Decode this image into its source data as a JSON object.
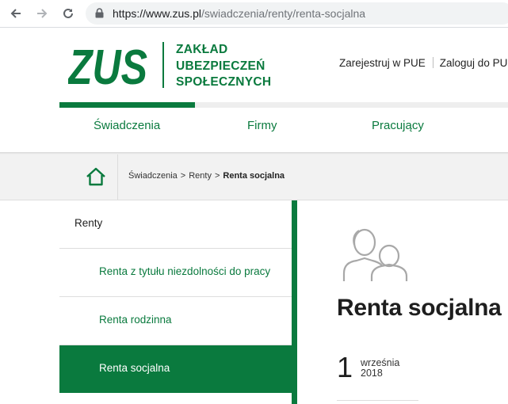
{
  "browser": {
    "url_host": "https://www.zus.pl",
    "url_path": "/swiadczenia/renty/renta-socjalna"
  },
  "header": {
    "logo_text": "ZUS",
    "name_line1": "ZAKŁAD",
    "name_line2": "UBEZPIECZEŃ",
    "name_line3": "SPOŁECZNYCH",
    "register_link": "Zarejestruj w PUE",
    "login_link": "Zaloguj do PU"
  },
  "colors": {
    "brand_green": "#0a7a3e",
    "breadcrumb_bg": "#f2f2f2"
  },
  "main_nav": {
    "items": [
      {
        "label": "Świadczenia",
        "active": true
      },
      {
        "label": "Firmy"
      },
      {
        "label": "Pracujący"
      }
    ]
  },
  "breadcrumb": {
    "home_icon": "home-icon",
    "items": [
      "Świadczenia",
      "Renty",
      "Renta socjalna"
    ],
    "separator": ">"
  },
  "side_menu": {
    "heading": "Renty",
    "items": [
      {
        "label": "Renta z tytułu niezdolności do pracy"
      },
      {
        "label": "Renta rodzinna"
      },
      {
        "label": "Renta socjalna",
        "active": true
      }
    ]
  },
  "content": {
    "icon": "people-icon",
    "title": "Renta socjalna",
    "date_day": "1",
    "date_month": "września",
    "date_year": "2018"
  }
}
